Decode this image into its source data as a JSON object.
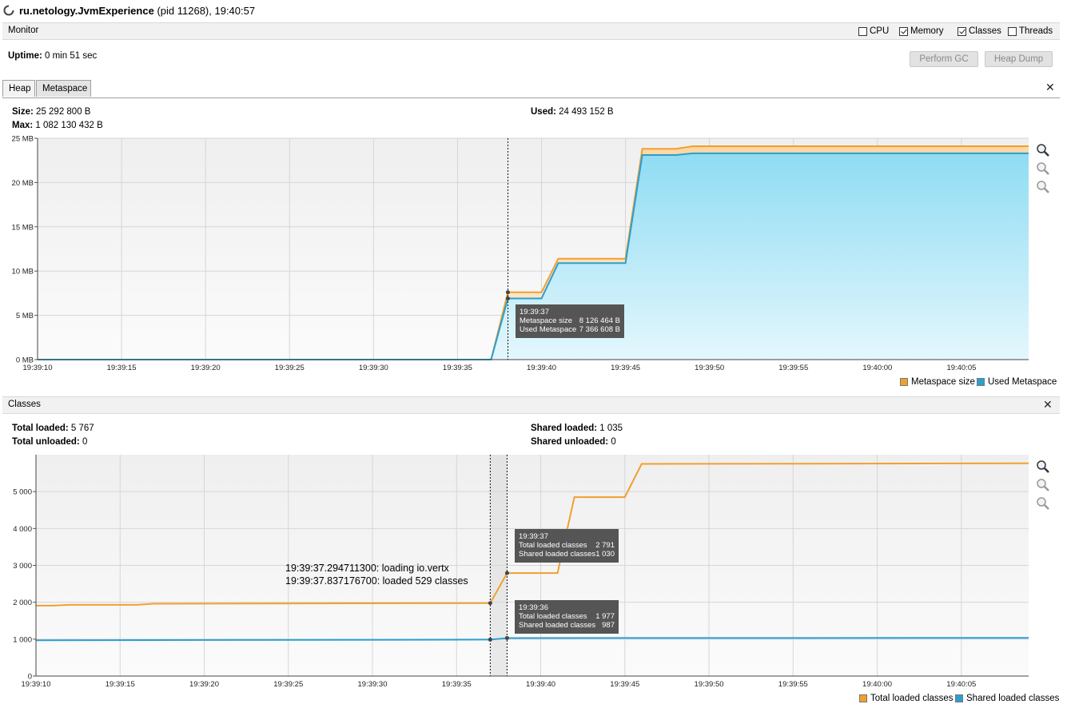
{
  "window": {
    "app_name": "ru.netology.JvmExperience",
    "pid_time": "(pid 11268), 19:40:57"
  },
  "monitor": {
    "label": "Monitor",
    "checkboxes": [
      {
        "label": "CPU",
        "checked": false
      },
      {
        "label": "Memory",
        "checked": true
      },
      {
        "label": "Classes",
        "checked": true
      },
      {
        "label": "Threads",
        "checked": false
      }
    ],
    "uptime_label": "Uptime:",
    "uptime_value": "0 min 51 sec",
    "perform_gc": "Perform GC",
    "heap_dump": "Heap Dump"
  },
  "tabs": [
    {
      "label": "Heap",
      "active": false
    },
    {
      "label": "Metaspace",
      "active": true
    }
  ],
  "metaspace": {
    "size_label": "Size:",
    "size_value": "25 292 800 B",
    "max_label": "Max:",
    "max_value": "1 082 130 432 B",
    "used_label": "Used:",
    "used_value": "24 493 152 B",
    "tooltip": {
      "time": "19:39:37",
      "rows": [
        {
          "label": "Metaspace size",
          "value": "8 126 464 B"
        },
        {
          "label": "Used Metaspace",
          "value": "7 366 608 B"
        }
      ]
    },
    "legend": [
      {
        "label": "Metaspace size",
        "color": "#f0a030"
      },
      {
        "label": "Used Metaspace",
        "color": "#2a9fd0"
      }
    ]
  },
  "classes": {
    "label": "Classes",
    "total_loaded_label": "Total loaded:",
    "total_loaded_value": "5 767",
    "total_unloaded_label": "Total unloaded:",
    "total_unloaded_value": "0",
    "shared_loaded_label": "Shared loaded:",
    "shared_loaded_value": "1 035",
    "shared_unloaded_label": "Shared unloaded:",
    "shared_unloaded_value": "0",
    "annotation": [
      "19:39:37.294711300: loading io.vertx",
      "19:39:37.837176700: loaded 529 classes"
    ],
    "tooltip1": {
      "time": "19:39:37",
      "rows": [
        {
          "label": "Total loaded classes",
          "value": "2 791"
        },
        {
          "label": "Shared loaded classes",
          "value": "1 030"
        }
      ]
    },
    "tooltip2": {
      "time": "19:39:36",
      "rows": [
        {
          "label": "Total loaded classes",
          "value": "1 977"
        },
        {
          "label": "Shared loaded classes",
          "value": "987"
        }
      ]
    },
    "legend": [
      {
        "label": "Total loaded classes",
        "color": "#f0a030"
      },
      {
        "label": "Shared loaded classes",
        "color": "#2a9fd0"
      }
    ]
  },
  "chart_data": [
    {
      "type": "area",
      "title": "",
      "x_unit": "seconds after 19:39:10",
      "xlim": [
        0,
        59
      ],
      "ylim": [
        0,
        25
      ],
      "y_ticks": [
        "0 MB",
        "5 MB",
        "10 MB",
        "15 MB",
        "20 MB",
        "25 MB"
      ],
      "x_ticks": [
        "19:39:10",
        "19:39:15",
        "19:39:20",
        "19:39:25",
        "19:39:30",
        "19:39:35",
        "19:39:40",
        "19:39:45",
        "19:39:50",
        "19:39:55",
        "19:40:00",
        "19:40:05"
      ],
      "series": [
        {
          "name": "Metaspace size",
          "color": "#f0a030",
          "points": [
            [
              0,
              0
            ],
            [
              27,
              0
            ],
            [
              28,
              7.6
            ],
            [
              30,
              7.6
            ],
            [
              31,
              11.4
            ],
            [
              35,
              11.4
            ],
            [
              36,
              23.8
            ],
            [
              38,
              23.8
            ],
            [
              39,
              24.1
            ],
            [
              59,
              24.1
            ]
          ]
        },
        {
          "name": "Used Metaspace",
          "color": "#2a9fd0",
          "points": [
            [
              0,
              0
            ],
            [
              27,
              0
            ],
            [
              28,
              6.9
            ],
            [
              30,
              6.9
            ],
            [
              31,
              10.9
            ],
            [
              35,
              10.9
            ],
            [
              36,
              23.1
            ],
            [
              38,
              23.1
            ],
            [
              39,
              23.3
            ],
            [
              59,
              23.3
            ]
          ]
        }
      ],
      "crosshair_x": 28
    },
    {
      "type": "line",
      "title": "",
      "x_unit": "seconds after 19:39:10",
      "xlim": [
        0,
        59
      ],
      "ylim": [
        0,
        6000
      ],
      "y_ticks": [
        "0",
        "1 000",
        "2 000",
        "3 000",
        "4 000",
        "5 000"
      ],
      "x_ticks": [
        "19:39:10",
        "19:39:15",
        "19:39:20",
        "19:39:25",
        "19:39:30",
        "19:39:35",
        "19:39:40",
        "19:39:45",
        "19:39:50",
        "19:39:55",
        "19:40:00",
        "19:40:05"
      ],
      "series": [
        {
          "name": "Total loaded classes",
          "color": "#f0a030",
          "points": [
            [
              0,
              1910
            ],
            [
              1,
              1910
            ],
            [
              2,
              1930
            ],
            [
              6,
              1930
            ],
            [
              7,
              1960
            ],
            [
              27,
              1977
            ],
            [
              28,
              2791
            ],
            [
              31,
              2791
            ],
            [
              32,
              4850
            ],
            [
              35,
              4850
            ],
            [
              36,
              5750
            ],
            [
              59,
              5767
            ]
          ]
        },
        {
          "name": "Shared loaded classes",
          "color": "#2a9fd0",
          "points": [
            [
              0,
              970
            ],
            [
              27,
              987
            ],
            [
              28,
              1030
            ],
            [
              59,
              1035
            ]
          ]
        }
      ],
      "crosshair_x": [
        27,
        28
      ]
    }
  ]
}
